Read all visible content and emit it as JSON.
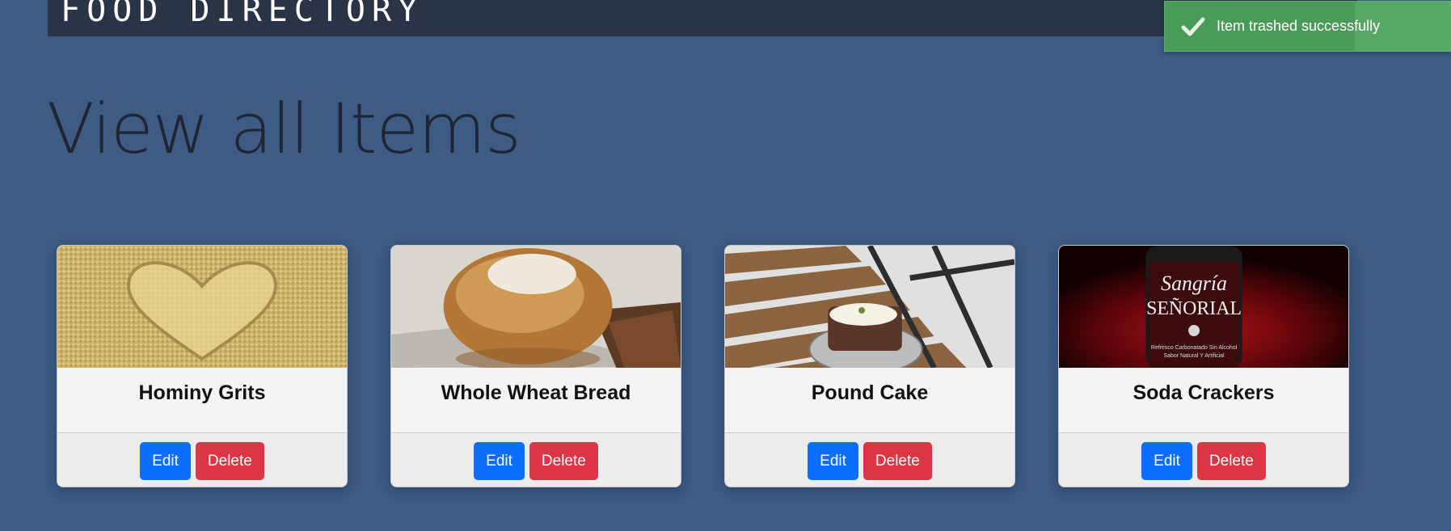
{
  "header": {
    "brand": "FOOD DIRECTORY"
  },
  "toast": {
    "message": "Item trashed successfully",
    "icon": "check-icon",
    "color": "#4a9a58"
  },
  "page": {
    "title": "View all Items"
  },
  "items": [
    {
      "name": "Hominy Grits",
      "image": "grits-heart-image",
      "edit_label": "Edit",
      "delete_label": "Delete"
    },
    {
      "name": "Whole Wheat Bread",
      "image": "bread-loaf-image",
      "edit_label": "Edit",
      "delete_label": "Delete"
    },
    {
      "name": "Pound Cake",
      "image": "pound-cake-image",
      "edit_label": "Edit",
      "delete_label": "Delete"
    },
    {
      "name": "Soda Crackers",
      "image": "sangria-bottle-image",
      "edit_label": "Edit",
      "delete_label": "Delete"
    }
  ],
  "colors": {
    "background": "#3d5b83",
    "edit_button": "#0d6efd",
    "delete_button": "#dc3545"
  }
}
